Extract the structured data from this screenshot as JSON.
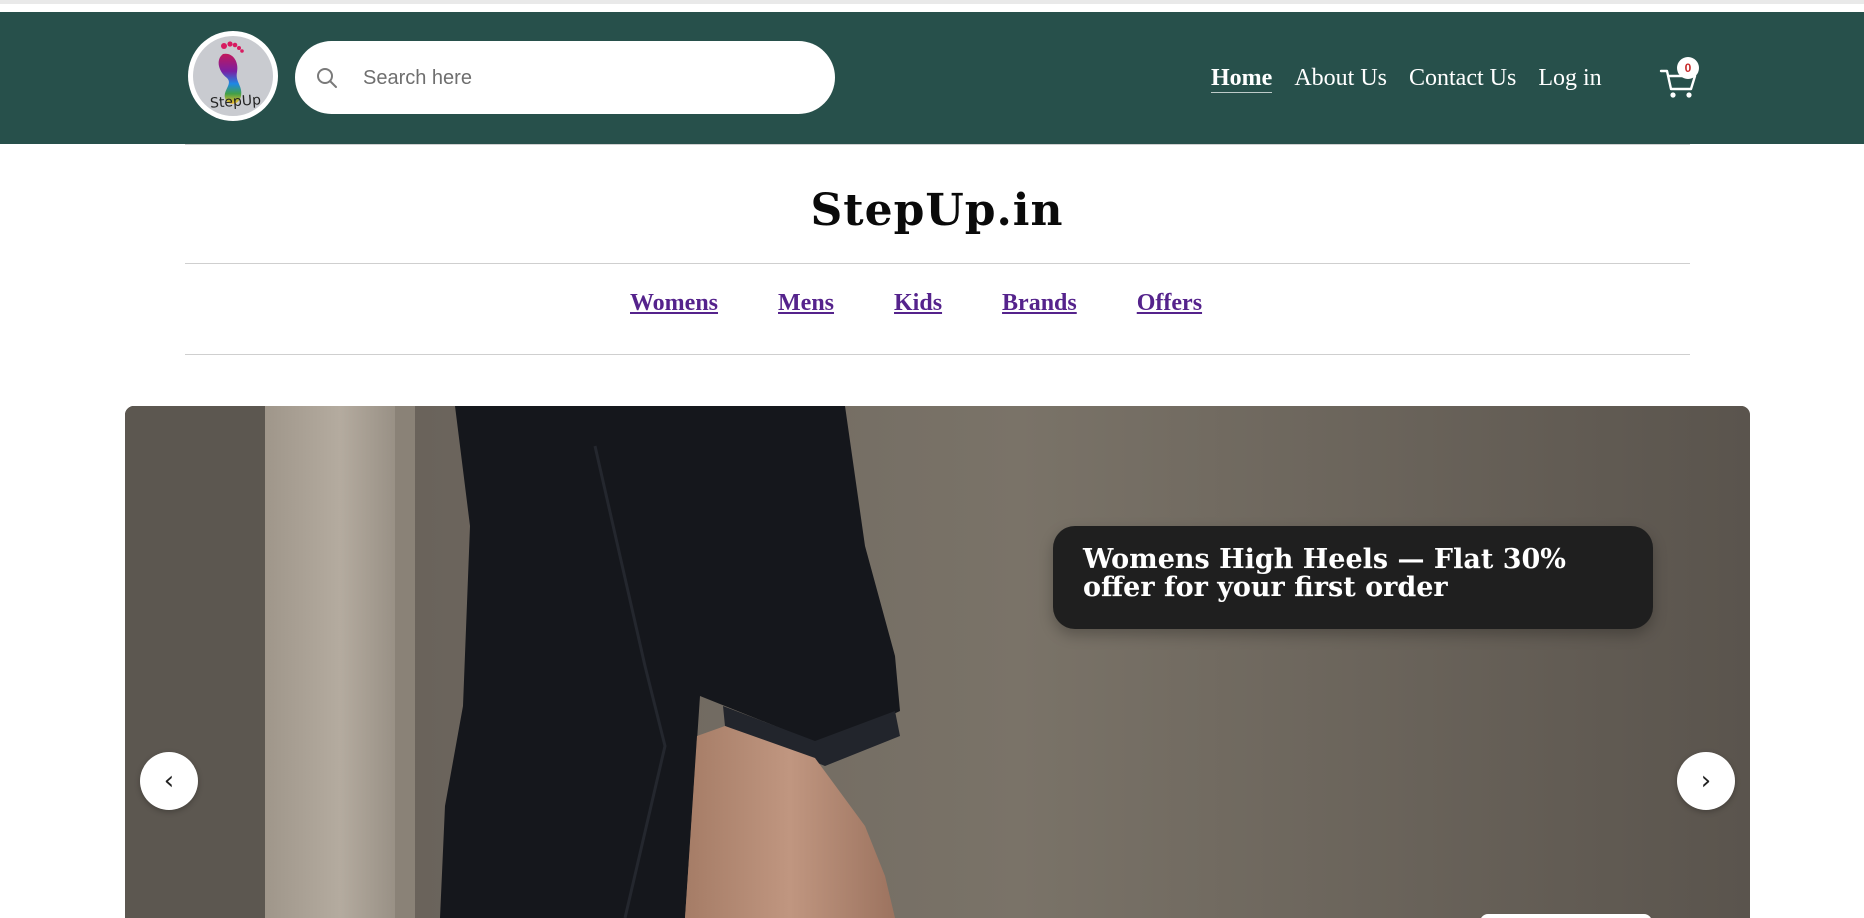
{
  "header": {
    "logo_text": "StepUp",
    "search": {
      "placeholder": "Search here",
      "value": ""
    },
    "nav": [
      {
        "label": "Home",
        "active": true
      },
      {
        "label": "About Us",
        "active": false
      },
      {
        "label": "Contact Us",
        "active": false
      },
      {
        "label": "Log in",
        "active": false
      }
    ],
    "cart_count": "0",
    "colors": {
      "header_bg": "#27504b",
      "cart_badge_text": "#c62828"
    }
  },
  "site_title": "StepUp.in",
  "categories": [
    {
      "label": "Womens"
    },
    {
      "label": "Mens"
    },
    {
      "label": "Kids"
    },
    {
      "label": "Brands"
    },
    {
      "label": "Offers"
    }
  ],
  "hero": {
    "promo_text": "Womens High Heels — Flat 30% offer for your first order",
    "prev_label": "‹",
    "next_label": "›",
    "colors": {
      "link": "#55238c",
      "promo_bg": "#1f1f1f"
    }
  },
  "icons": {
    "search": "search-icon",
    "cart": "cart-icon",
    "prev": "chevron-left-icon",
    "next": "chevron-right-icon"
  }
}
